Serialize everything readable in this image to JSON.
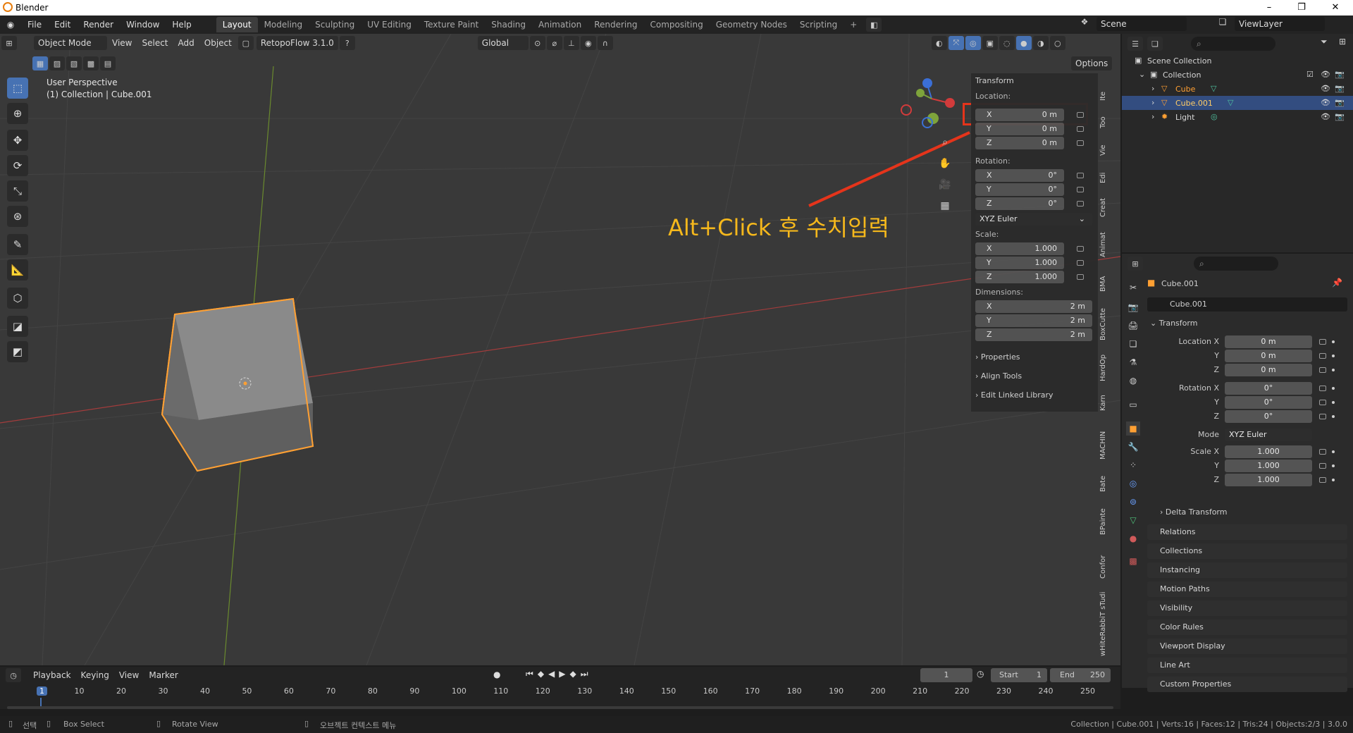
{
  "window": {
    "title": "Blender",
    "controls": [
      "–",
      "❐",
      "✕"
    ]
  },
  "menu": [
    "File",
    "Edit",
    "Render",
    "Window",
    "Help"
  ],
  "workspaces": [
    "Layout",
    "Modeling",
    "Sculpting",
    "UV Editing",
    "Texture Paint",
    "Shading",
    "Animation",
    "Rendering",
    "Compositing",
    "Geometry Nodes",
    "Scripting"
  ],
  "scene": {
    "scene_name": "Scene",
    "view_layer": "ViewLayer"
  },
  "viewport_header": {
    "mode": "Object Mode",
    "menus": [
      "View",
      "Select",
      "Add",
      "Object"
    ],
    "addon": "RetopoFlow 3.1.0",
    "transform_orientation": "Global",
    "options": "Options"
  },
  "overlay_text": {
    "line1": "User Perspective",
    "line2": "(1) Collection | Cube.001"
  },
  "annotation": {
    "text": "Alt+Click 후 수치입력",
    "accent": "#e5341b",
    "text_color": "#f5b81c"
  },
  "n_panel": {
    "title": "Transform",
    "location_label": "Location:",
    "location": [
      {
        "axis": "X",
        "value": "0 m"
      },
      {
        "axis": "Y",
        "value": "0 m"
      },
      {
        "axis": "Z",
        "value": "0 m"
      }
    ],
    "rotation_label": "Rotation:",
    "rotation": [
      {
        "axis": "X",
        "value": "0°"
      },
      {
        "axis": "Y",
        "value": "0°"
      },
      {
        "axis": "Z",
        "value": "0°"
      }
    ],
    "rotation_mode": "XYZ Euler",
    "scale_label": "Scale:",
    "scale": [
      {
        "axis": "X",
        "value": "1.000"
      },
      {
        "axis": "Y",
        "value": "1.000"
      },
      {
        "axis": "Z",
        "value": "1.000"
      }
    ],
    "dimensions_label": "Dimensions:",
    "dimensions": [
      {
        "axis": "X",
        "value": "2 m"
      },
      {
        "axis": "Y",
        "value": "2 m"
      },
      {
        "axis": "Z",
        "value": "2 m"
      }
    ],
    "collapsed": [
      "Properties",
      "Align Tools",
      "Edit Linked Library"
    ],
    "tabs": [
      "Ite",
      "Too",
      "Vie",
      "Edi",
      "Creat",
      "Animat",
      "BMA",
      "BoxCutte",
      "HardOp",
      "Karn",
      "MACHIN",
      "Bate",
      "BPainte",
      "Confor",
      "wHiteRabbiT sTudi"
    ]
  },
  "outliner": {
    "root": "Scene Collection",
    "collection": "Collection",
    "items": [
      {
        "name": "Cube",
        "selected": false
      },
      {
        "name": "Cube.001",
        "selected": true
      },
      {
        "name": "Light",
        "selected": false
      }
    ]
  },
  "properties": {
    "object_name": "Cube.001",
    "datablock": "Cube.001",
    "transform_title": "Transform",
    "location": [
      {
        "label": "Location X",
        "value": "0 m"
      },
      {
        "label": "Y",
        "value": "0 m"
      },
      {
        "label": "Z",
        "value": "0 m"
      }
    ],
    "rotation": [
      {
        "label": "Rotation X",
        "value": "0°"
      },
      {
        "label": "Y",
        "value": "0°"
      },
      {
        "label": "Z",
        "value": "0°"
      }
    ],
    "mode_label": "Mode",
    "mode_value": "XYZ Euler",
    "scale": [
      {
        "label": "Scale X",
        "value": "1.000"
      },
      {
        "label": "Y",
        "value": "1.000"
      },
      {
        "label": "Z",
        "value": "1.000"
      }
    ],
    "delta": "Delta Transform",
    "sections": [
      "Relations",
      "Collections",
      "Instancing",
      "Motion Paths",
      "Visibility",
      "Color Rules",
      "Viewport Display",
      "Line Art",
      "Custom Properties"
    ]
  },
  "timeline": {
    "menus": [
      "Playback",
      "Keying",
      "View",
      "Marker"
    ],
    "current_frame": "1",
    "start_label": "Start",
    "start": "1",
    "end_label": "End",
    "end": "250",
    "ticks": [
      "1",
      "10",
      "20",
      "30",
      "40",
      "50",
      "60",
      "70",
      "80",
      "90",
      "100",
      "110",
      "120",
      "130",
      "140",
      "150",
      "160",
      "170",
      "180",
      "190",
      "200",
      "210",
      "220",
      "230",
      "240",
      "250"
    ]
  },
  "status_bar": {
    "select": "선택",
    "box_select": "Box Select",
    "rotate_view": "Rotate View",
    "context_menu": "오브젝트 컨텍스트 메뉴",
    "stats": "Collection | Cube.001 | Verts:16 | Faces:12 | Tris:24 | Objects:2/3 | 3.0.0"
  },
  "colors": {
    "accent": "#4772b3",
    "selected_orange": "#ffa033",
    "x_axis": "#bb3b3b",
    "y_axis": "#7ea33b",
    "outliner_sel": "#334d80"
  }
}
